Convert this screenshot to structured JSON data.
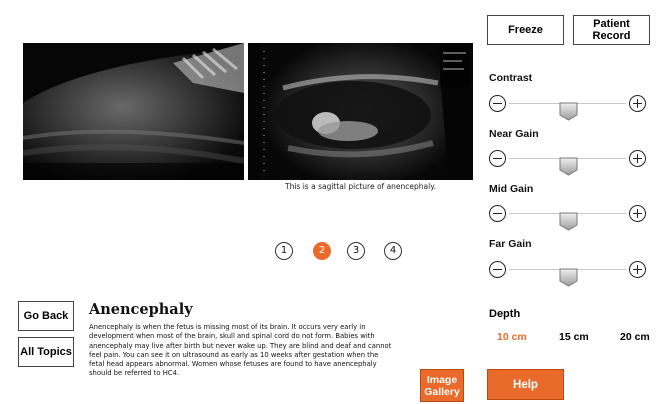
{
  "images": {
    "left_alt": "ultrasound image 1",
    "right_alt": "sagittal ultrasound image of anencephaly",
    "caption": "This is a sagittal picture of anencephaly."
  },
  "pagination": {
    "pages": [
      "1",
      "2",
      "3",
      "4"
    ],
    "active_index": 1
  },
  "buttons": {
    "freeze": "Freeze",
    "patient_record_line1": "Patient",
    "patient_record_line2": "Record",
    "go_back": "Go Back",
    "all_topics": "All Topics",
    "image_gallery_line1": "Image",
    "image_gallery_line2": "Gallery",
    "help": "Help"
  },
  "topic": {
    "title": "Anencephaly",
    "body": "Anencephaly is when the fetus is missing most of its brain.  It occurs very early in development when most of the brain, skull and spinal cord do not form.  Babies with anencephaly may live after birth but never wake up.  They are blind and deaf and cannot feel pain. You can see it on ultrasound as early as 10 weeks after gestation when the fetal head appears abnormal. Women whose fetuses are found to have anencephaly should be referred to HC4."
  },
  "controls": [
    {
      "label": "Contrast",
      "level": 0.5
    },
    {
      "label": "Near Gain",
      "level": 0.5
    },
    {
      "label": "Mid Gain",
      "level": 0.5
    },
    {
      "label": "Far Gain",
      "level": 0.5
    }
  ],
  "depth": {
    "label": "Depth",
    "options": [
      "10 cm",
      "15 cm",
      "20 cm"
    ],
    "selected_index": 0
  },
  "colors": {
    "accent": "#e96a2a"
  }
}
